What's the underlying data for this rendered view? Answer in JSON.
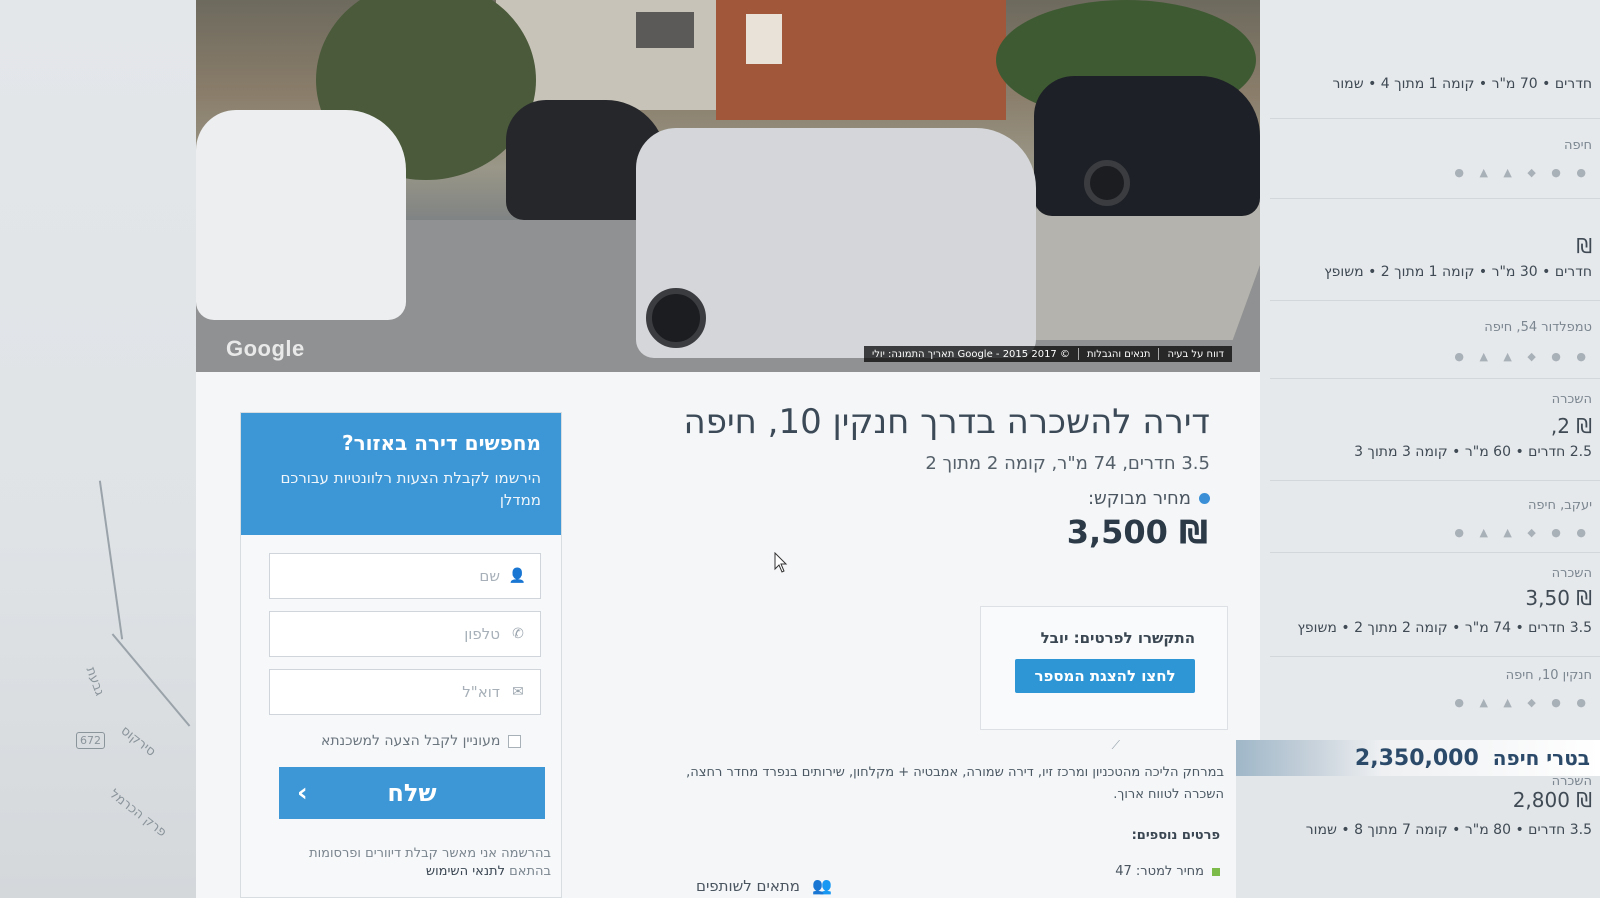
{
  "streetview": {
    "google_logo": "Google",
    "copyright": "© 2017 Google - 2015 תאריך התמונה: יולי",
    "terms": "תנאים והגבלות",
    "report": "דווח על בעיה"
  },
  "listing": {
    "title": "דירה להשכרה בדרך חנקין 10, חיפה",
    "subtitle": "3.5 חדרים, 74 מ\"ר, קומה 2 מתוך 2",
    "price_label": "מחיר מבוקש:",
    "price": "₪ 3,500",
    "contact_title": "התקשרו לפרטים: יובל",
    "show_number_button": "לחצו להצגת המספר",
    "description_line1": "במרחק הליכה מהטכניון ומרכז זיו, דירה שמורה, אמבטיה + מקלחון, שירותים בנפרד מחדר רחצה,",
    "description_line2": "השכרה לטווח ארוך.",
    "more_details_title": "פרטים נוספים:",
    "meter_price": "מחיר למטר: 47",
    "roommates": "מתאים לשותפים"
  },
  "signup": {
    "title": "מחפשים דירה באזור?",
    "subtitle": "הירשמו לקבלת הצעות רלוונטיות עבורכם ממדלן",
    "name_placeholder": "שם",
    "phone_placeholder": "טלפון",
    "email_placeholder": "דוא\"ל",
    "consent_label": "מעוניין לקבל הצעה למשכנתא",
    "send_button": "שלח",
    "terms_text": "בהרשמה אני מאשר קבלת דיוורים ופרסומות",
    "terms_prefix": "בהתאם",
    "terms_link": "לתנאי השימוש"
  },
  "sidebar": {
    "item1_details": "חדרים • 70 מ\"ר • קומה 1 מתוך 4 • שמור",
    "item1_city": "חיפה",
    "item2_price": "₪",
    "item2_details": "חדרים • 30 מ\"ר • קומה 1 מתוך 2 • משופץ",
    "item2_street": "טמפלדור 54, חיפה",
    "item3_label": "השכרה",
    "item3_price": "₪ 2,",
    "item3_details": "2.5 חדרים • 60 מ\"ר • קומה 3 מתוך 3",
    "item3_street": "יעקב, חיפה",
    "item4_label": "השכרה",
    "item4_price": "₪ 3,50",
    "item4_details": "3.5 חדרים • 74 מ\"ר • קומה 2 מתוך 2 • משופץ",
    "item4_street": "חנקין 10, חיפה",
    "banner_city": "בטרי חיפה",
    "banner_price": "2,350,000",
    "item5_label": "השכרה",
    "item5_price": "₪ 2,800",
    "item5_details": "3.5 חדרים • 80 מ\"ר • קומה 7 מתוך 8 • שמור"
  },
  "map": {
    "route_number": "672",
    "label1": "סירקוס",
    "label2": "פרק הכרמל",
    "label3": "גבעת"
  }
}
